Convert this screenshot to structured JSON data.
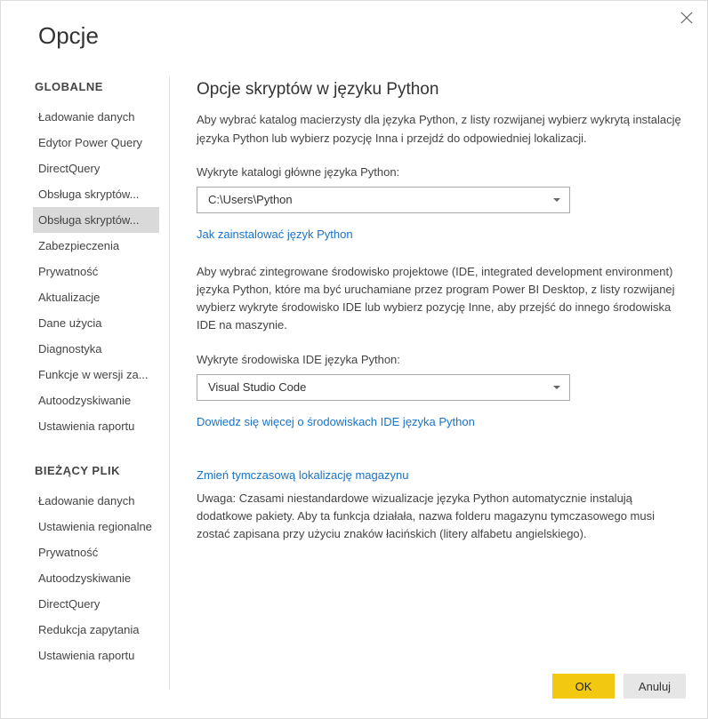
{
  "dialog": {
    "title": "Opcje"
  },
  "sidebar": {
    "section1_header": "GLOBALNE",
    "section1_items": [
      "Ładowanie danych",
      "Edytor Power Query",
      "DirectQuery",
      "Obsługa skryptów...",
      "Obsługa skryptów...",
      "Zabezpieczenia",
      "Prywatność",
      "Aktualizacje",
      "Dane użycia",
      "Diagnostyka",
      "Funkcje w wersji za...",
      "Autoodzyskiwanie",
      "Ustawienia raportu"
    ],
    "section2_header": "BIEŻĄCY PLIK",
    "section2_items": [
      "Ładowanie danych",
      "Ustawienia regionalne",
      "Prywatność",
      "Autoodzyskiwanie",
      "DirectQuery",
      "Redukcja zapytania",
      "Ustawienia raportu"
    ]
  },
  "content": {
    "title": "Opcje skryptów w języku Python",
    "desc1": "Aby wybrać katalog macierzysty dla języka Python, z listy rozwijanej wybierz wykrytą instalację języka Python lub wybierz pozycję Inna i przejdź do odpowiedniej lokalizacji.",
    "label1": "Wykryte katalogi główne języka Python:",
    "dropdown1": "C:\\Users\\Python",
    "link1": "Jak zainstalować język Python",
    "desc2": "Aby wybrać zintegrowane środowisko projektowe (IDE, integrated development environment) języka Python, które ma być uruchamiane przez program Power BI Desktop, z listy rozwijanej wybierz wykryte środowisko IDE lub wybierz pozycję Inne, aby przejść do innego środowiska IDE na maszynie.",
    "label2": "Wykryte środowiska IDE języka Python:",
    "dropdown2": "Visual Studio Code",
    "link2": "Dowiedz się więcej o środowiskach IDE języka Python",
    "link3": "Zmień tymczasową lokalizację magazynu",
    "note": "Uwaga: Czasami niestandardowe wizualizacje języka Python automatycznie instalują dodatkowe pakiety. Aby ta funkcja działała, nazwa folderu magazynu tymczasowego musi zostać zapisana przy użyciu znaków łacińskich (litery alfabetu angielskiego)."
  },
  "footer": {
    "ok": "OK",
    "cancel": "Anuluj"
  }
}
